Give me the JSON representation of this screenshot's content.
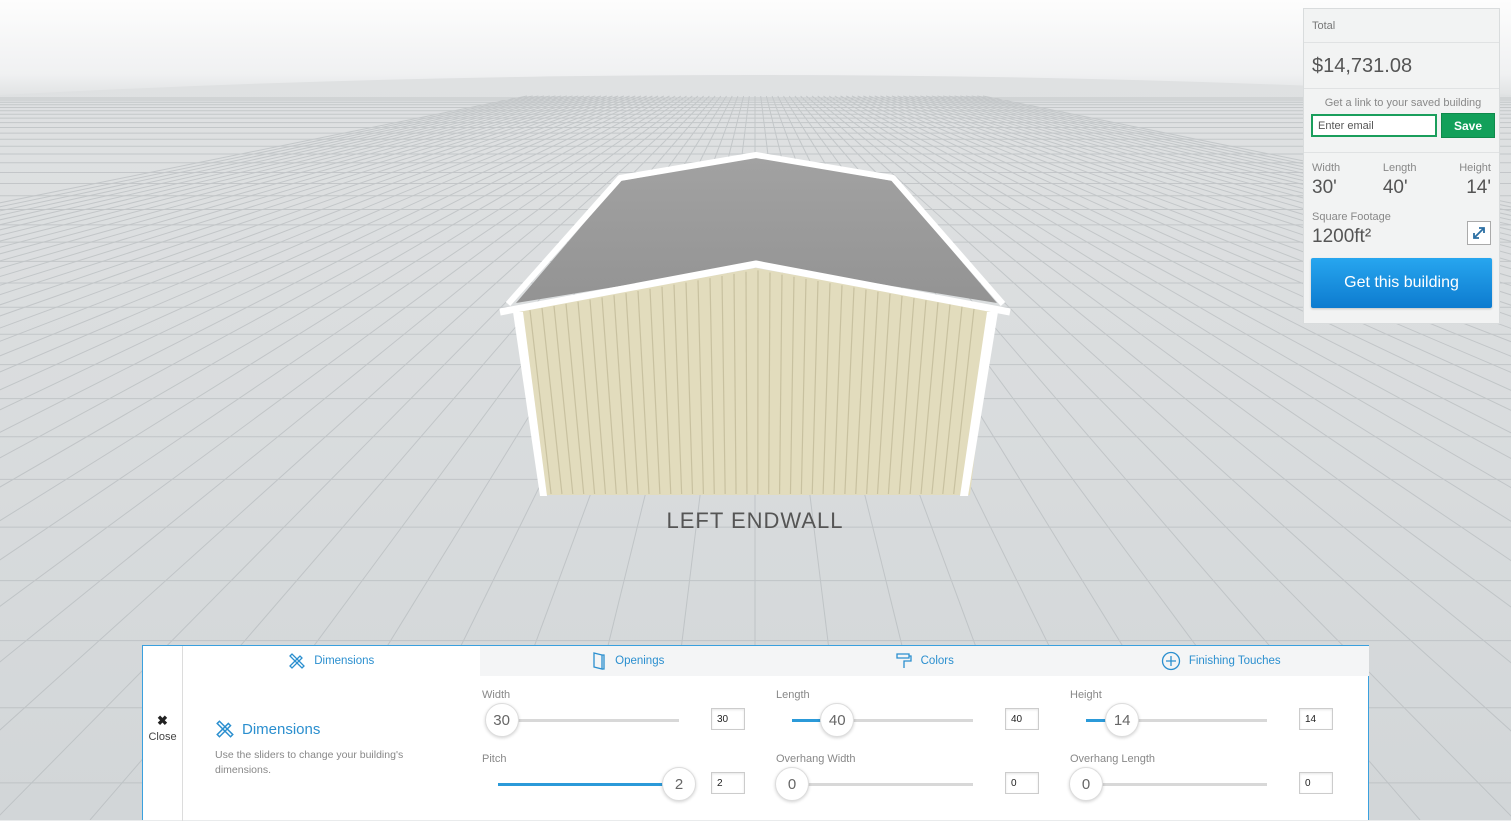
{
  "summary": {
    "total_label": "Total",
    "total_value": "$14,731.08",
    "email_prompt": "Get a link to your saved building",
    "email_placeholder": "Enter email",
    "save_label": "Save",
    "width_label": "Width",
    "width_value": "30'",
    "length_label": "Length",
    "length_value": "40'",
    "height_label": "Height",
    "height_value": "14'",
    "sqft_label": "Square Footage",
    "sqft_value": "1200ft²",
    "get_button": "Get this building"
  },
  "scene": {
    "wall_label": "LEFT ENDWALL",
    "colors": {
      "roof": "#9c9c9c",
      "wall": "#e2dcbd",
      "trim": "#ffffff"
    }
  },
  "panel": {
    "close_label": "Close",
    "tabs": [
      {
        "label": "Dimensions",
        "icon": "ruler-pencil-icon",
        "active": true
      },
      {
        "label": "Openings",
        "icon": "door-icon",
        "active": false
      },
      {
        "label": "Colors",
        "icon": "paint-roller-icon",
        "active": false
      },
      {
        "label": "Finishing Touches",
        "icon": "plus-circle-icon",
        "active": false
      }
    ],
    "section_title": "Dimensions",
    "section_desc": "Use the sliders to change your building's dimensions.",
    "accent_color": "#2b8fcf",
    "controls": [
      {
        "label": "Width",
        "value": "30",
        "input": "30",
        "fill": 0.02
      },
      {
        "label": "Length",
        "value": "40",
        "input": "40",
        "fill": 0.25
      },
      {
        "label": "Height",
        "value": "14",
        "input": "14",
        "fill": 0.2
      },
      {
        "label": "Pitch",
        "value": "2",
        "input": "2",
        "fill": 1.0
      },
      {
        "label": "Overhang Width",
        "value": "0",
        "input": "0",
        "fill": 0.0
      },
      {
        "label": "Overhang Length",
        "value": "0",
        "input": "0",
        "fill": 0.0
      }
    ]
  }
}
